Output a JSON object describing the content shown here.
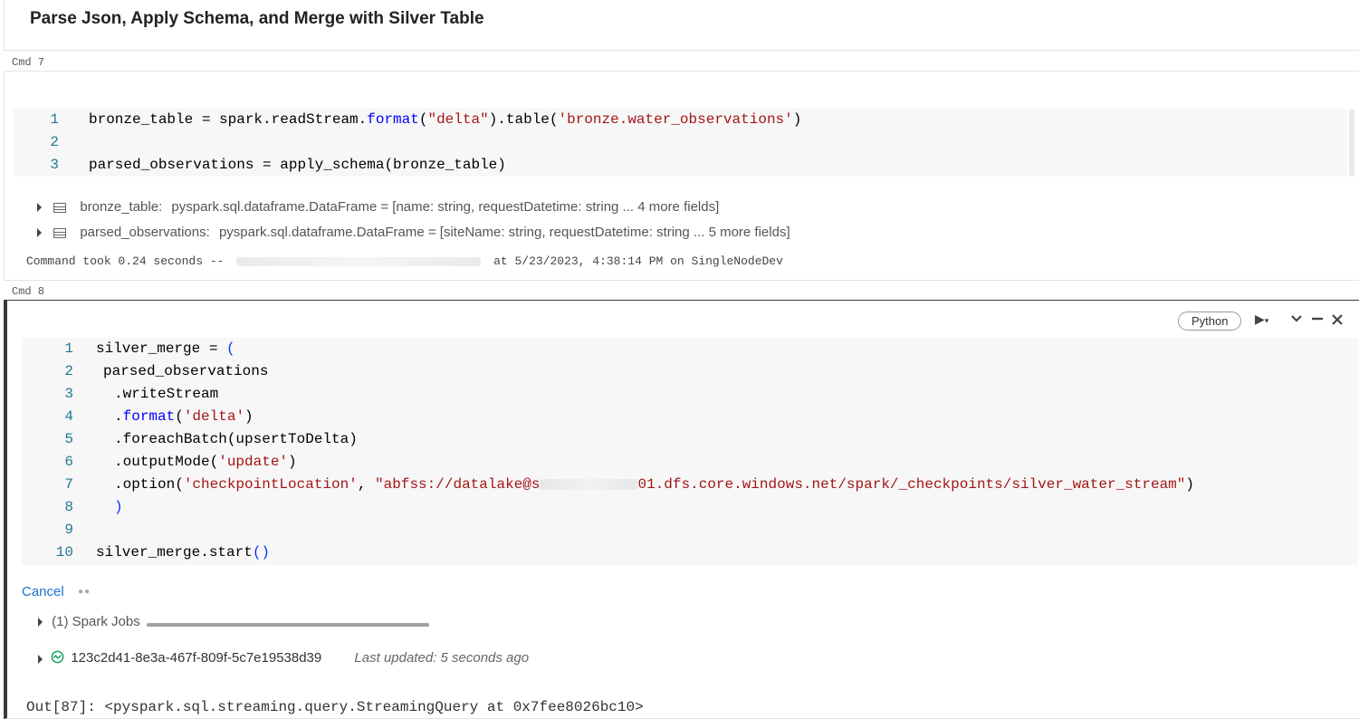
{
  "markdown_cell": {
    "title": "Parse Json, Apply Schema, and Merge with Silver Table"
  },
  "cmd7": {
    "label": "Cmd 7",
    "lines": [
      {
        "n": "1",
        "code": [
          [
            "t",
            "bronze_table = spark.readStream."
          ],
          [
            "k",
            "format"
          ],
          [
            "t",
            "("
          ],
          [
            "s",
            "\"delta\""
          ],
          [
            "t",
            ").table("
          ],
          [
            "s",
            "'bronze.water_observations'"
          ],
          [
            "t",
            ")"
          ]
        ]
      },
      {
        "n": "2",
        "code": []
      },
      {
        "n": "3",
        "code": [
          [
            "t",
            "parsed_observations = apply_schema(bronze_table)"
          ]
        ]
      }
    ],
    "outputs": [
      {
        "name": "bronze_table:",
        "type": "pyspark.sql.dataframe.DataFrame = [name: string, requestDatetime: string ... 4 more fields]"
      },
      {
        "name": "parsed_observations:",
        "type": "pyspark.sql.dataframe.DataFrame = [siteName: string, requestDatetime: string ... 5 more fields]"
      }
    ],
    "took_prefix": "Command took 0.24 seconds --",
    "took_suffix": "at 5/23/2023, 4:38:14 PM on SingleNodeDev"
  },
  "cmd8": {
    "label": "Cmd 8",
    "language": "Python",
    "lines": [
      {
        "n": "1",
        "indent": 0,
        "code": [
          [
            "t",
            "silver_merge = "
          ],
          [
            "p",
            "("
          ]
        ]
      },
      {
        "n": "2",
        "indent": 2,
        "code": [
          [
            "t",
            "parsed_observations"
          ]
        ]
      },
      {
        "n": "3",
        "indent": 5,
        "code": [
          [
            "t",
            ".writeStream"
          ]
        ]
      },
      {
        "n": "4",
        "indent": 5,
        "code": [
          [
            "t",
            "."
          ],
          [
            "k",
            "format"
          ],
          [
            "t",
            "("
          ],
          [
            "s",
            "'delta'"
          ],
          [
            "t",
            ")"
          ]
        ]
      },
      {
        "n": "5",
        "indent": 5,
        "code": [
          [
            "t",
            ".foreachBatch(upsertToDelta)"
          ]
        ]
      },
      {
        "n": "6",
        "indent": 5,
        "code": [
          [
            "t",
            ".outputMode("
          ],
          [
            "s",
            "'update'"
          ],
          [
            "t",
            ")"
          ]
        ]
      },
      {
        "n": "7",
        "indent": 5,
        "code": [
          [
            "t",
            ".option("
          ],
          [
            "s",
            "'checkpointLocation'"
          ],
          [
            "t",
            ", "
          ],
          [
            "s",
            "\"abfss://datalake@s"
          ],
          [
            "b",
            ""
          ],
          [
            "s",
            "01.dfs.core.windows.net/spark/_checkpoints/silver_water_stream\""
          ],
          [
            "t",
            ")"
          ]
        ]
      },
      {
        "n": "8",
        "indent": 5,
        "code": [
          [
            "p",
            ")"
          ]
        ]
      },
      {
        "n": "9",
        "indent": 0,
        "code": []
      },
      {
        "n": "10",
        "indent": 0,
        "code": [
          [
            "t",
            "silver_merge.start"
          ],
          [
            "p",
            "()"
          ]
        ]
      }
    ],
    "cancel_label": "Cancel",
    "spark_jobs_label": "(1) Spark Jobs",
    "stream_id": "123c2d41-8e3a-467f-809f-5c7e19538d39",
    "last_updated": "Last updated: 5 seconds ago",
    "out": "Out[87]: <pyspark.sql.streaming.query.StreamingQuery at 0x7fee8026bc10>"
  },
  "colors": {
    "accent_blue": "#1a73c7",
    "stream_green": "#1aa260",
    "string_red": "#a31515",
    "keyword_blue": "#0000ff"
  },
  "icons": [
    "table-icon",
    "caret-right-icon",
    "run-icon",
    "chevron-down-icon",
    "minimize-icon",
    "close-icon",
    "stream-status-icon"
  ]
}
